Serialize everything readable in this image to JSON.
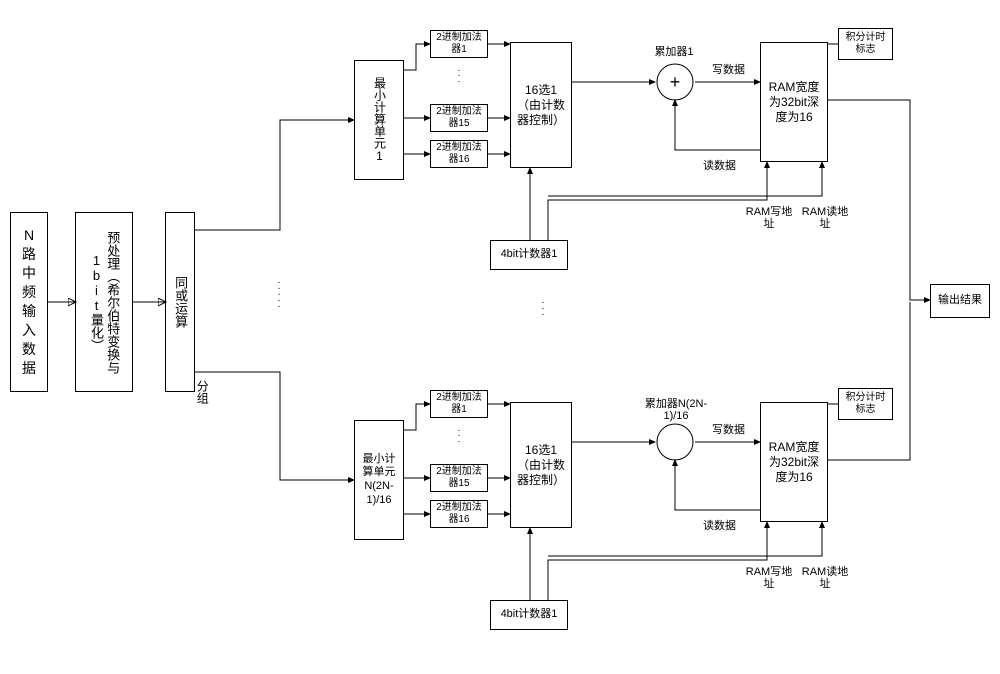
{
  "input": "N\n路\n中\n频\n输\n入\n数\n据",
  "preprocess": "预处理（希尔伯特变换与1bit量化）",
  "xnor": "同或运算",
  "group_label": "分组",
  "upper": {
    "mincell": "最小计算单元1",
    "adders": {
      "a1": "2进制加法器1",
      "a15": "2进制加法器15",
      "a16": "2进制加法器16"
    },
    "mux": "16选1\n（由计数器控制）",
    "counter": "4bit计数器1",
    "acc_label": "累加器1",
    "write_label": "写数据",
    "read_label": "读数据",
    "ram": "RAM宽度为32bit深度为16",
    "waddr_label": "RAM写地址",
    "raddr_label": "RAM读地址",
    "int_flag": "积分计时标志"
  },
  "lower": {
    "mincell": "最小计算单元N(2N-1)/16",
    "adders": {
      "a1": "2进制加法器1",
      "a15": "2进制加法器15",
      "a16": "2进制加法器16"
    },
    "mux": "16选1\n（由计数器控制）",
    "counter": "4bit计数器1",
    "acc_label": "累加器N(2N-1)/16",
    "write_label": "写数据",
    "read_label": "读数据",
    "ram": "RAM宽度为32bit深度为16",
    "waddr_label": "RAM写地址",
    "raddr_label": "RAM读地址",
    "int_flag": "积分计时标志"
  },
  "output": "输出结果",
  "plus_sign": "+"
}
